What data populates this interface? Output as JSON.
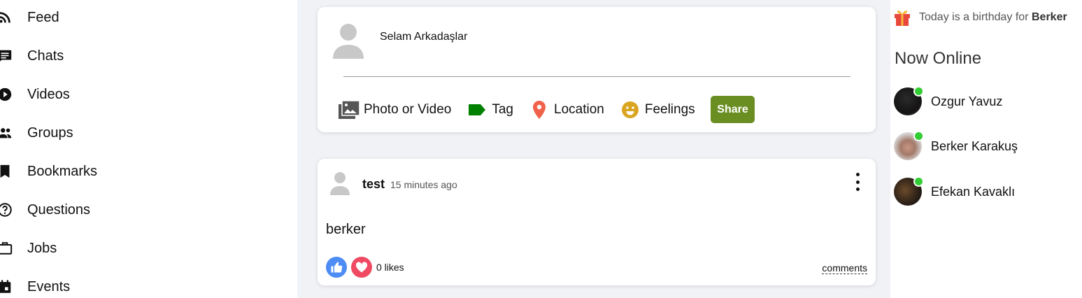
{
  "sidebar": {
    "items": [
      {
        "label": "Feed",
        "icon": "rss-icon"
      },
      {
        "label": "Chats",
        "icon": "chat-icon"
      },
      {
        "label": "Videos",
        "icon": "play-circle-icon"
      },
      {
        "label": "Groups",
        "icon": "group-icon"
      },
      {
        "label": "Bookmarks",
        "icon": "bookmark-icon"
      },
      {
        "label": "Questions",
        "icon": "help-circle-icon"
      },
      {
        "label": "Jobs",
        "icon": "briefcase-icon"
      },
      {
        "label": "Events",
        "icon": "calendar-icon"
      }
    ]
  },
  "share": {
    "input_text": "Selam Arkadaşlar",
    "options": [
      {
        "label": "Photo or Video",
        "icon": "photo-library-icon",
        "color": "#555555"
      },
      {
        "label": "Tag",
        "icon": "label-tag-icon",
        "color": "#008000"
      },
      {
        "label": "Location",
        "icon": "location-pin-icon",
        "color": "#f0634a"
      },
      {
        "label": "Feelings",
        "icon": "emoji-icon",
        "color": "#daa520"
      }
    ],
    "button_label": "Share",
    "button_color": "#6b8e23"
  },
  "post": {
    "username": "test",
    "time": "15 minutes ago",
    "text": "berker",
    "likes": "0 likes",
    "comments_label": "comments"
  },
  "rightbar": {
    "birthday_prefix": "Today is a birthday for",
    "birthday_name": "Berker",
    "online_title": "Now Online",
    "friends": [
      {
        "name": "Ozgur Yavuz"
      },
      {
        "name": "Berker Karakuş"
      },
      {
        "name": "Efekan Kavaklı"
      }
    ],
    "online_color": "#32cd32"
  }
}
